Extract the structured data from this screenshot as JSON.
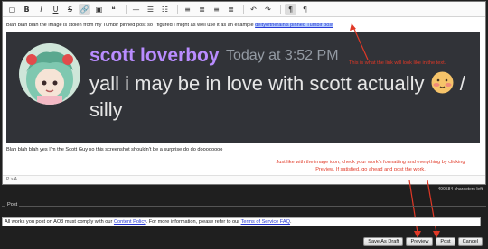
{
  "toolbar": {
    "buttons": [
      "source-code",
      "bold",
      "italic",
      "underline",
      "strikethrough",
      "link",
      "image",
      "quote",
      "horizontal-rule",
      "bullet-list",
      "numbered-list",
      "align-left",
      "align-center",
      "align-right",
      "align-justify",
      "undo",
      "redo",
      "paragraph",
      "text-direction"
    ],
    "glyphs": [
      "▢",
      "B",
      "I",
      "U",
      "S",
      "🔗",
      "▣",
      "❝",
      "—",
      "☰",
      "☷",
      "≡",
      "≣",
      "≡",
      "≣",
      "↶",
      "↷",
      "¶",
      "¶"
    ]
  },
  "editor": {
    "line1_text": "Blah blah blah the image is stolen from my Tumblr pinned post so I figured I might as well use it as an example ",
    "link_text": "deityoftherain's pinned Tumblr post",
    "line2_text": "Blah blah blah yes I'm the Scott Guy so this screenshot shouldn't be a surprise do do doooooooo",
    "status_label": "P > A"
  },
  "discord": {
    "username": "scott loverboy",
    "timestamp": "Today at 3:52 PM",
    "message_part1": "yall i may be in love with scott actually",
    "message_part2": "/ silly",
    "colors": {
      "bg": "#313338",
      "username": "#b98cff",
      "timestamp": "#949ba4",
      "text": "#e6e6e6"
    }
  },
  "annotations": {
    "note1": "This is what the link will look like in the text.",
    "note2": "Just like with the image icon, check your work's formatting and everything by clicking Preview. If satisfied, go ahead and post the work.",
    "color": "#e03826"
  },
  "char_counter": "499584 characters left",
  "post_section": {
    "legend": "Post",
    "policy_prefix": "All works you post on AO3 must comply with our ",
    "policy_link": "Content Policy",
    "policy_middle": ". For more information, please refer to our ",
    "tos_link": "Terms of Service FAQ",
    "policy_suffix": "."
  },
  "buttons": {
    "save_draft": "Save As Draft",
    "preview": "Preview",
    "post": "Post",
    "cancel": "Cancel"
  }
}
